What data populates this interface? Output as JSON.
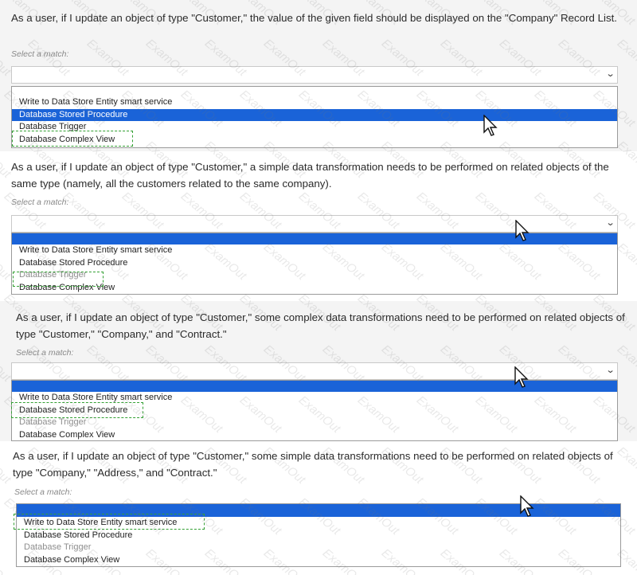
{
  "hint_text": "Select a match:",
  "options": [
    "Write to Data Store Entity smart service",
    "Database Stored Procedure",
    "Database Trigger",
    "Database Complex View"
  ],
  "questions": [
    {
      "text": "As a user, if I update an object of type \"Customer,\" the value of the given field should be displayed on the \"Company\" Record List."
    },
    {
      "text": "As a user, if I update an object of type \"Customer,\" a simple data transformation needs to be performed on related objects of the same type (namely, all the customers related to the same company)."
    },
    {
      "text": "As a user, if I update an object of type \"Customer,\" some complex data transformations need to be performed on related objects of type \"Customer,\" \"Company,\" and \"Contract.\""
    },
    {
      "text": "As a user, if I update an object of type \"Customer,\" some simple data transformations need to be performed on related objects of type \"Company,\" \"Address,\" and \"Contract.\""
    }
  ],
  "watermark_text": "ExamOut",
  "accent_color": "#1a63d8",
  "answer_mark_color": "#33a033",
  "icons": {
    "dropdown": "chevron-down-icon",
    "pointer": "mouse-cursor-icon"
  }
}
